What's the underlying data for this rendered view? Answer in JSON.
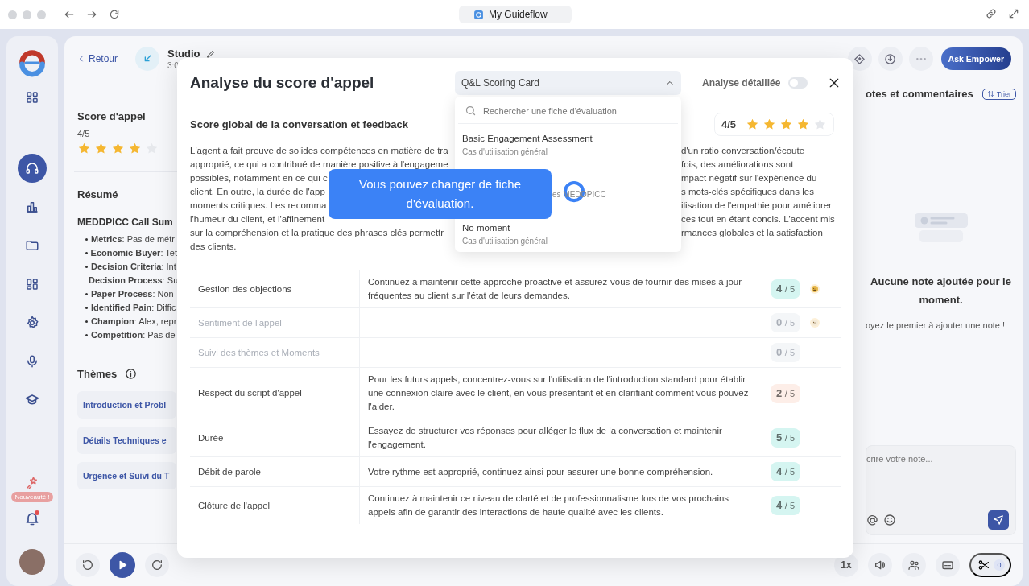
{
  "browser": {
    "tab_title": "My Guideflow"
  },
  "rail": {
    "items": [
      {
        "kind": "grid",
        "selected": false
      },
      {
        "kind": "headset",
        "selected": true
      },
      {
        "kind": "chart",
        "selected": false
      },
      {
        "kind": "folder",
        "selected": false
      },
      {
        "kind": "widgets",
        "selected": false
      },
      {
        "kind": "gear",
        "selected": false
      },
      {
        "kind": "mic",
        "selected": false
      },
      {
        "kind": "cap",
        "selected": false
      }
    ],
    "new_badge": "Nouveauté !",
    "bell_unread": true
  },
  "header": {
    "back": "Retour",
    "title": "Studio",
    "duration": "3:0",
    "ask_button": "Ask Empower"
  },
  "studio": {
    "score_title": "Score d'appel",
    "score": "4/5",
    "stars": 4,
    "summary_title": "Résumé",
    "summary_heading": "MEDDPICC Call Sum",
    "bullets": [
      "**Metrics**: Pas de métr",
      "**Economic Buyer**: Tet",
      "**Decision Criteria**: Int",
      "**Decision Process**: Su",
      "**Paper Process**: Non",
      "**Identified Pain**: Diffic",
      "**Champion**: Alex, repr",
      "**Competition**: Pas de"
    ],
    "themes_title": "Thèmes",
    "themes": [
      "Introduction et Probl",
      "Détails Techniques e",
      "Urgence et Suivi du T"
    ]
  },
  "notes": {
    "title": "otes et commentaires",
    "sort": "Trier",
    "empty_title": "Aucune note ajoutée pour le moment.",
    "empty_hint": "oyez le premier à ajouter une note !",
    "placeholder": "crire votre note..."
  },
  "player": {
    "speed": "1x",
    "clips": "0"
  },
  "modal": {
    "title": "Analyse du score d'appel",
    "scorecard": {
      "value": "Q&L Scoring Card",
      "expanded": true,
      "search_placeholder": "Rechercher une fiche d'évaluation",
      "options": [
        {
          "name": "Basic Engagement Assessment",
          "subtitle": "Cas d'utilisation général"
        },
        {
          "subtitle": "es MEDDPICC"
        },
        {
          "name": "No moment",
          "subtitle": "Cas d'utilisation général"
        }
      ]
    },
    "detailed": {
      "label": "Analyse détaillée",
      "on": false
    },
    "section_title": "Score global de la conversation et feedback",
    "score": "4/5",
    "stars": 4,
    "summary_left": [
      "L'agent a fait preuve de solides compétences en matière de tra",
      "approprié, ce qui a contribué de manière positive à l'engageme",
      "possibles, notamment en ce qui c",
      "client. En outre, la durée de l'app",
      "moments critiques. Les recomma",
      "l'humeur du client, et l'affinement",
      "sur la compréhension et la pratique des phrases clés permettr",
      "des clients."
    ],
    "summary_right": [
      "d'un ratio conversation/écoute",
      "fois, des améliorations sont",
      "mpact négatif sur l'expérience du",
      "s mots-clés spécifiques dans les",
      "ilisation de l'empathie pour améliorer",
      "ces tout en étant concis. L'accent mis",
      "rmances globales et la satisfaction"
    ],
    "tooltip": "Vous pouvez changer de fiche d'évaluation.",
    "rows": [
      {
        "name": "Gestion des objections",
        "feedback": "Continuez à maintenir cette approche proactive et assurez-vous de fournir des mises à jour fréquentes au client sur l'état de leurs demandes.",
        "score": "4",
        "max": "/ 5",
        "color": "#d5f5f1",
        "disabled": false,
        "emoji": true
      },
      {
        "name": "Sentiment de l'appel",
        "feedback": "",
        "score": "0",
        "max": "/ 5",
        "color": "#f4f6f8",
        "disabled": true,
        "emoji": true
      },
      {
        "name": "Suivi des thèmes et Moments",
        "feedback": "",
        "score": "0",
        "max": "/ 5",
        "color": "#f4f6f8",
        "disabled": true,
        "emoji": false
      },
      {
        "name": "Respect du script d'appel",
        "feedback": "Pour les futurs appels, concentrez-vous sur l'utilisation de l'introduction standard pour établir une connexion claire avec le client, en vous présentant et en clarifiant comment vous pouvez l'aider.",
        "score": "2",
        "max": "/ 5",
        "color": "#fdeee8",
        "disabled": false,
        "emoji": false
      },
      {
        "name": "Durée",
        "feedback": "Essayez de structurer vos réponses pour alléger le flux de la conversation et maintenir l'engagement.",
        "score": "5",
        "max": "/ 5",
        "color": "#d5f5f1",
        "disabled": false,
        "emoji": false
      },
      {
        "name": "Débit de parole",
        "feedback": "Votre rythme est approprié, continuez ainsi pour assurer une bonne compréhension.",
        "score": "4",
        "max": "/ 5",
        "color": "#d5f5f1",
        "disabled": false,
        "emoji": false
      },
      {
        "name": "Clôture de l'appel",
        "feedback": "Continuez à maintenir ce niveau de clarté et de professionnalisme lors de vos prochains appels afin de garantir des interactions de haute qualité avec les clients.",
        "score": "4",
        "max": "/ 5",
        "color": "#d5f5f1",
        "disabled": false,
        "emoji": false
      }
    ]
  }
}
